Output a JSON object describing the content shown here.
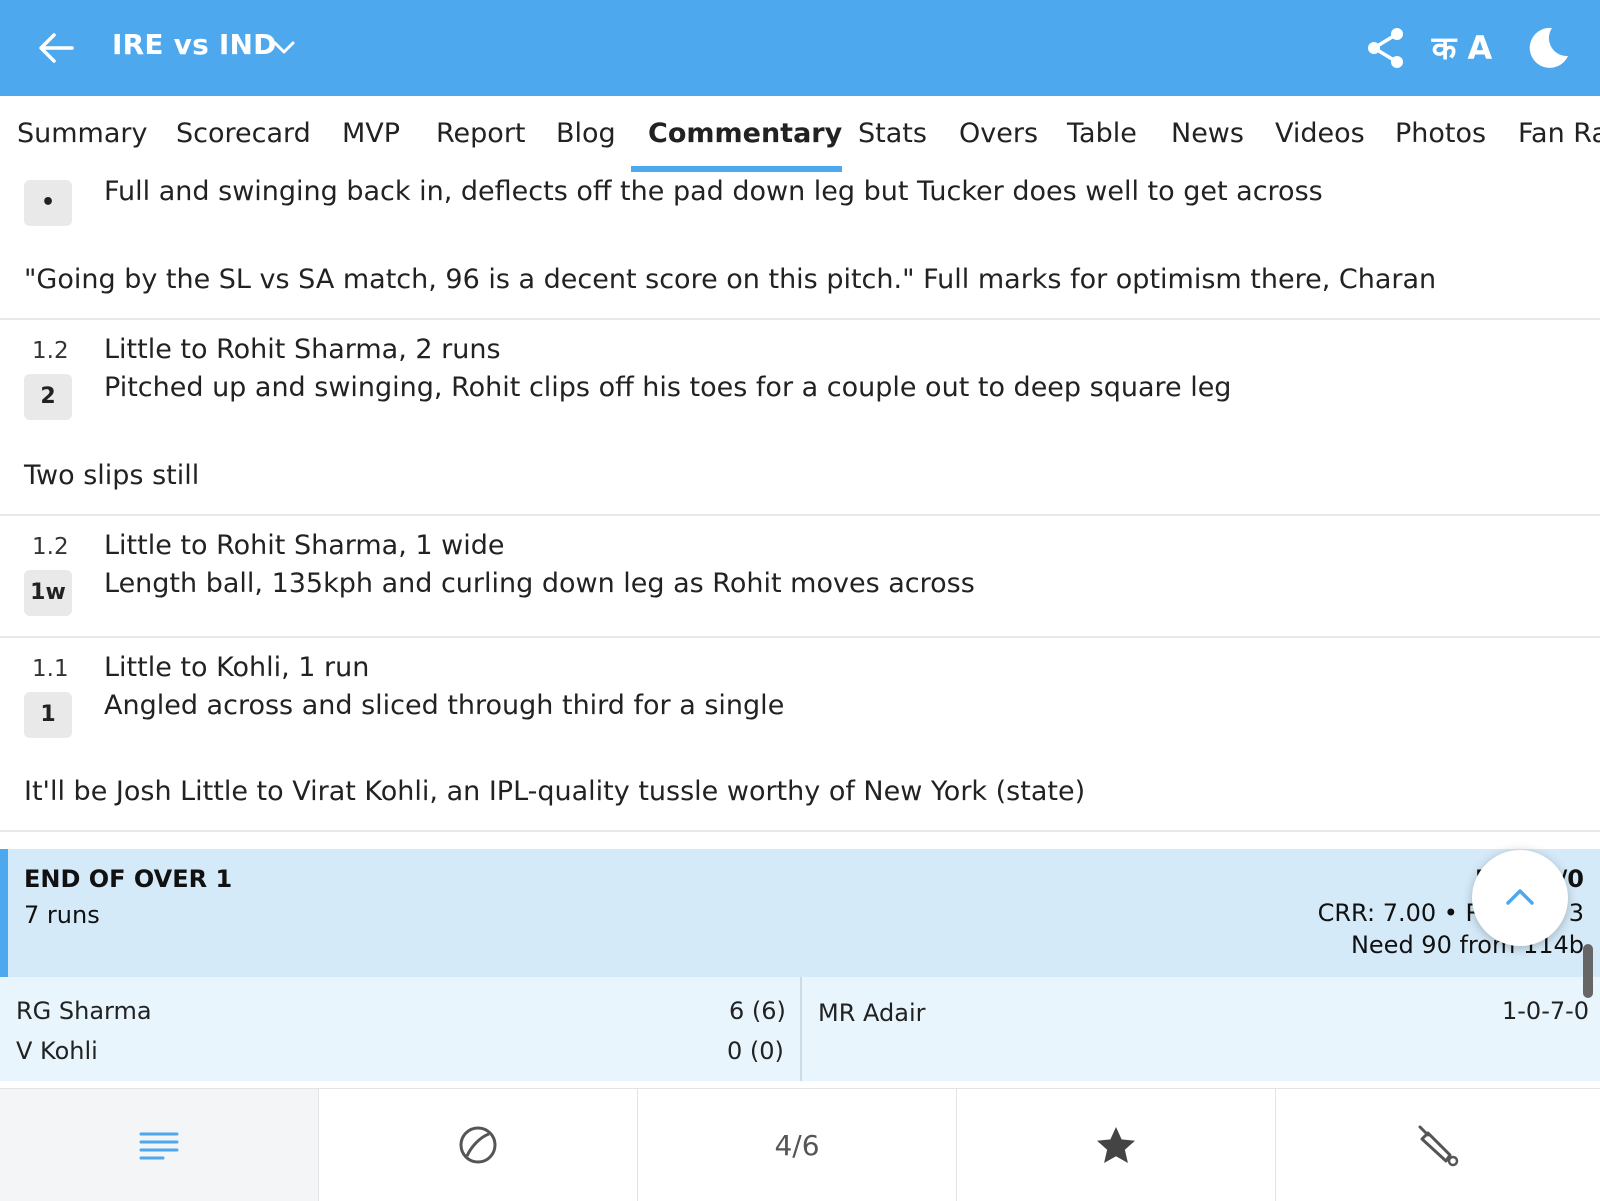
{
  "header": {
    "title": "IRE vs IND",
    "lang_label": "क A"
  },
  "tabs": [
    {
      "label": "Summary"
    },
    {
      "label": "Scorecard"
    },
    {
      "label": "MVP"
    },
    {
      "label": "Report"
    },
    {
      "label": "Blog"
    },
    {
      "label": "Commentary",
      "active": true
    },
    {
      "label": "Stats"
    },
    {
      "label": "Overs"
    },
    {
      "label": "Table"
    },
    {
      "label": "News"
    },
    {
      "label": "Videos"
    },
    {
      "label": "Photos"
    },
    {
      "label": "Fan Ra"
    }
  ],
  "feed": {
    "top_ball": {
      "badge": "•",
      "text": "Full and swinging back in, deflects off the pad down leg but Tucker does well to get across"
    },
    "note1": "\"Going by the SL vs SA match, 96 is a decent score on this pitch.\" Full marks for optimism there, Charan",
    "ball2": {
      "over": "1.2",
      "badge": "2",
      "title": "Little to Rohit Sharma, 2 runs",
      "text": "Pitched up and swinging, Rohit clips off his toes for a couple out to deep square leg"
    },
    "note2": "Two slips still",
    "ball3": {
      "over": "1.2",
      "badge": "1w",
      "title": "Little to Rohit Sharma, 1 wide",
      "text": "Length ball, 135kph and curling down leg as Rohit moves across"
    },
    "ball4": {
      "over": "1.1",
      "badge": "1",
      "title": "Little to Kohli, 1 run",
      "text": "Angled across and sliced through third for a single"
    },
    "note3": "It'll be Josh Little to Virat Kohli, an IPL-quality tussle worthy of New York (state)"
  },
  "end_of_over": {
    "heading": "END OF OVER 1",
    "runs": "7 runs",
    "score": "IND: 7/0",
    "crr": "CRR: 7.00 • RRR: 5.73",
    "need": "Need 90 from 114b"
  },
  "batters": [
    {
      "name": "RG Sharma",
      "score": "6 (6)"
    },
    {
      "name": "V Kohli",
      "score": "0 (0)"
    }
  ],
  "bowler": {
    "name": "MR Adair",
    "figures": "1-0-7-0"
  },
  "bottom_nav": {
    "page": "4/6"
  },
  "colors": {
    "brand": "#4ea8ee",
    "over_band": "#d5eaf9",
    "batters_band": "#e9f5fd"
  },
  "icons": [
    "back-arrow-icon",
    "chevron-down-icon",
    "share-icon",
    "language-icon",
    "moon-icon",
    "menu-lines-icon",
    "ball-icon",
    "star-icon",
    "bat-icon",
    "chevron-up-icon"
  ]
}
